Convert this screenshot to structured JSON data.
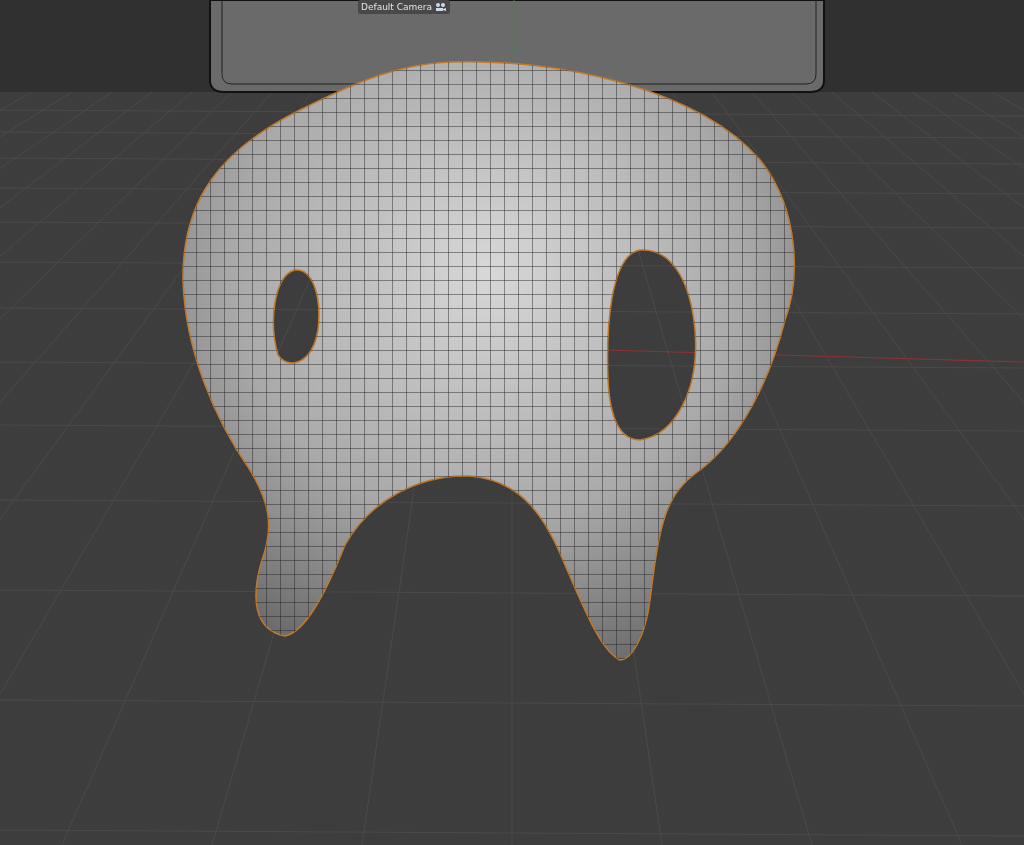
{
  "viewport": {
    "object_label": "Default Camera"
  }
}
